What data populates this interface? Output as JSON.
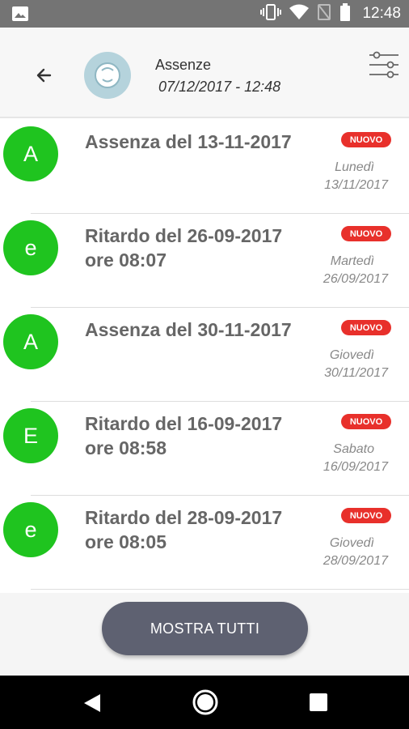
{
  "status_bar": {
    "time": "12:48",
    "icons": [
      "image-icon",
      "vibrate-icon",
      "wifi-icon",
      "no-signal-icon",
      "battery-icon"
    ]
  },
  "header": {
    "title": "Assenze",
    "subtitle": "07/12/2017 - 12:48",
    "back_icon": "arrow-left-icon",
    "filter_icon": "sliders-icon"
  },
  "items": [
    {
      "letter": "A",
      "title": "Assenza del 13-11-2017",
      "badge": "NUOVO",
      "day": "Lunedì",
      "date": "13/11/2017"
    },
    {
      "letter": "e",
      "title": "Ritardo del 26-09-2017 ore 08:07",
      "badge": "NUOVO",
      "day": "Martedì",
      "date": "26/09/2017"
    },
    {
      "letter": "A",
      "title": "Assenza del 30-11-2017",
      "badge": "NUOVO",
      "day": "Giovedì",
      "date": "30/11/2017"
    },
    {
      "letter": "E",
      "title": "Ritardo del 16-09-2017 ore 08:58",
      "badge": "NUOVO",
      "day": "Sabato",
      "date": "16/09/2017"
    },
    {
      "letter": "e",
      "title": "Ritardo del 28-09-2017 ore 08:05",
      "badge": "NUOVO",
      "day": "Giovedì",
      "date": "28/09/2017"
    }
  ],
  "footer": {
    "show_all_label": "MOSTRA TUTTI"
  },
  "colors": {
    "badge_green": "#1fc41f",
    "new_red": "#e8302b",
    "button_gray": "#5e6171"
  }
}
